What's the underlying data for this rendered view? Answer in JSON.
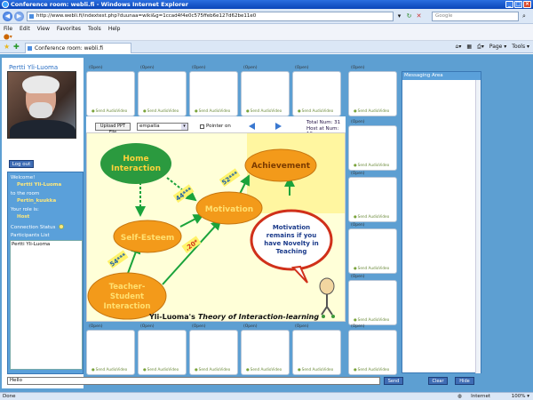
{
  "window": {
    "title": "Conference room: webli.fi - Windows Internet Explorer"
  },
  "address": {
    "url": "http://www.webli.fi/indextest.php?duunaa=wiki&g=1ccad4f4e0c575ffeb6e127d62be11e0"
  },
  "search": {
    "placeholder": "Google"
  },
  "menu": {
    "items": [
      "File",
      "Edit",
      "View",
      "Favorites",
      "Tools",
      "Help"
    ]
  },
  "tab": {
    "label": "Conference room: webli.fi"
  },
  "tabtools": {
    "items": [
      "Page ▾",
      "Tools ▾"
    ]
  },
  "user": {
    "name": "Pertti Yli-Luoma"
  },
  "sidebar": {
    "logout_label": "Log out",
    "welcome_label": "Welcome!",
    "welcome_name": "Pertti Yli-Luoma",
    "room_label": "to the room",
    "room_name": "Pertin_kuukka",
    "role_label": "Your role is:",
    "role": "Host",
    "connection_label": "Connection Status",
    "participants_label": "Participants List",
    "participants": [
      "Pertti Yli-Luoma"
    ]
  },
  "slots": {
    "open_label": "(Open)",
    "link_label": "Send AudioVideo"
  },
  "controls": {
    "upload_label": "Upload PPT File",
    "file_value": "empatia",
    "pointer_label": "Pointer on",
    "total_num": "Total Num:  31",
    "host_num": "Host at Num: 10"
  },
  "slide": {
    "nodes": {
      "home": [
        "Home",
        "Interaction"
      ],
      "achievement": "Achievement",
      "motivation": "Motivation",
      "self_esteem": "Self-Esteem",
      "teacher": [
        "Teacher-",
        "Student",
        "Interaction"
      ]
    },
    "coefficients": {
      "c1": "52***",
      "c2": "44***",
      "c3": "54***",
      "c4": ".20*"
    },
    "bubble": [
      "Motivation",
      "remains if you",
      "have Novelty in",
      "Teaching"
    ],
    "caption_name": "Yli-Luoma's",
    "caption_title": "Theory of Interaction-learning"
  },
  "messaging": {
    "header": "Messaging Area"
  },
  "chat": {
    "value": "Hello",
    "send_label": "Send",
    "clear_label": "Clear",
    "hide_label": "Hide"
  },
  "status": {
    "left": "Done",
    "zone": "Internet",
    "zoom": "100% ▾"
  },
  "colors": {
    "page_bg": "#5d9fd2",
    "node_orange": "#f39a1a",
    "node_green": "#2b9a3f",
    "arrow_green": "#1aa33b"
  }
}
